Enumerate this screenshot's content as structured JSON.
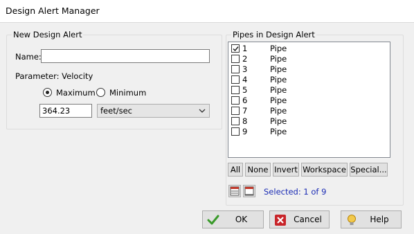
{
  "window": {
    "title": "Design Alert Manager"
  },
  "new_alert": {
    "legend": "New Design Alert",
    "name_label": "Name:",
    "name_value": "",
    "parameter_label": "Parameter: Velocity",
    "maximum_label": "Maximum",
    "minimum_label": "Minimum",
    "selected_limit": "Maximum",
    "value": "364.23",
    "unit": "feet/sec"
  },
  "pipes": {
    "legend": "Pipes in Design Alert",
    "rows": [
      {
        "number": "1",
        "name": "Pipe",
        "checked": true
      },
      {
        "number": "2",
        "name": "Pipe",
        "checked": false
      },
      {
        "number": "3",
        "name": "Pipe",
        "checked": false
      },
      {
        "number": "4",
        "name": "Pipe",
        "checked": false
      },
      {
        "number": "5",
        "name": "Pipe",
        "checked": false
      },
      {
        "number": "6",
        "name": "Pipe",
        "checked": false
      },
      {
        "number": "7",
        "name": "Pipe",
        "checked": false
      },
      {
        "number": "8",
        "name": "Pipe",
        "checked": false
      },
      {
        "number": "9",
        "name": "Pipe",
        "checked": false
      }
    ],
    "buttons": {
      "all": "All",
      "none": "None",
      "invert": "Invert",
      "workspace": "Workspace",
      "special": "Special..."
    },
    "selected_text": "Selected: 1 of 9"
  },
  "footer": {
    "ok": "OK",
    "cancel": "Cancel",
    "help": "Help"
  },
  "colors": {
    "selected_text": "#1a2bb4",
    "ok_check": "#3a9a2a",
    "cancel_red": "#c8252a",
    "help_yellow": "#f2c94c"
  },
  "icons": {
    "ok": "checkmark-icon",
    "cancel": "x-icon",
    "help": "lightbulb-icon",
    "list_view": "list-view-icon",
    "columns_view": "columns-view-icon"
  }
}
